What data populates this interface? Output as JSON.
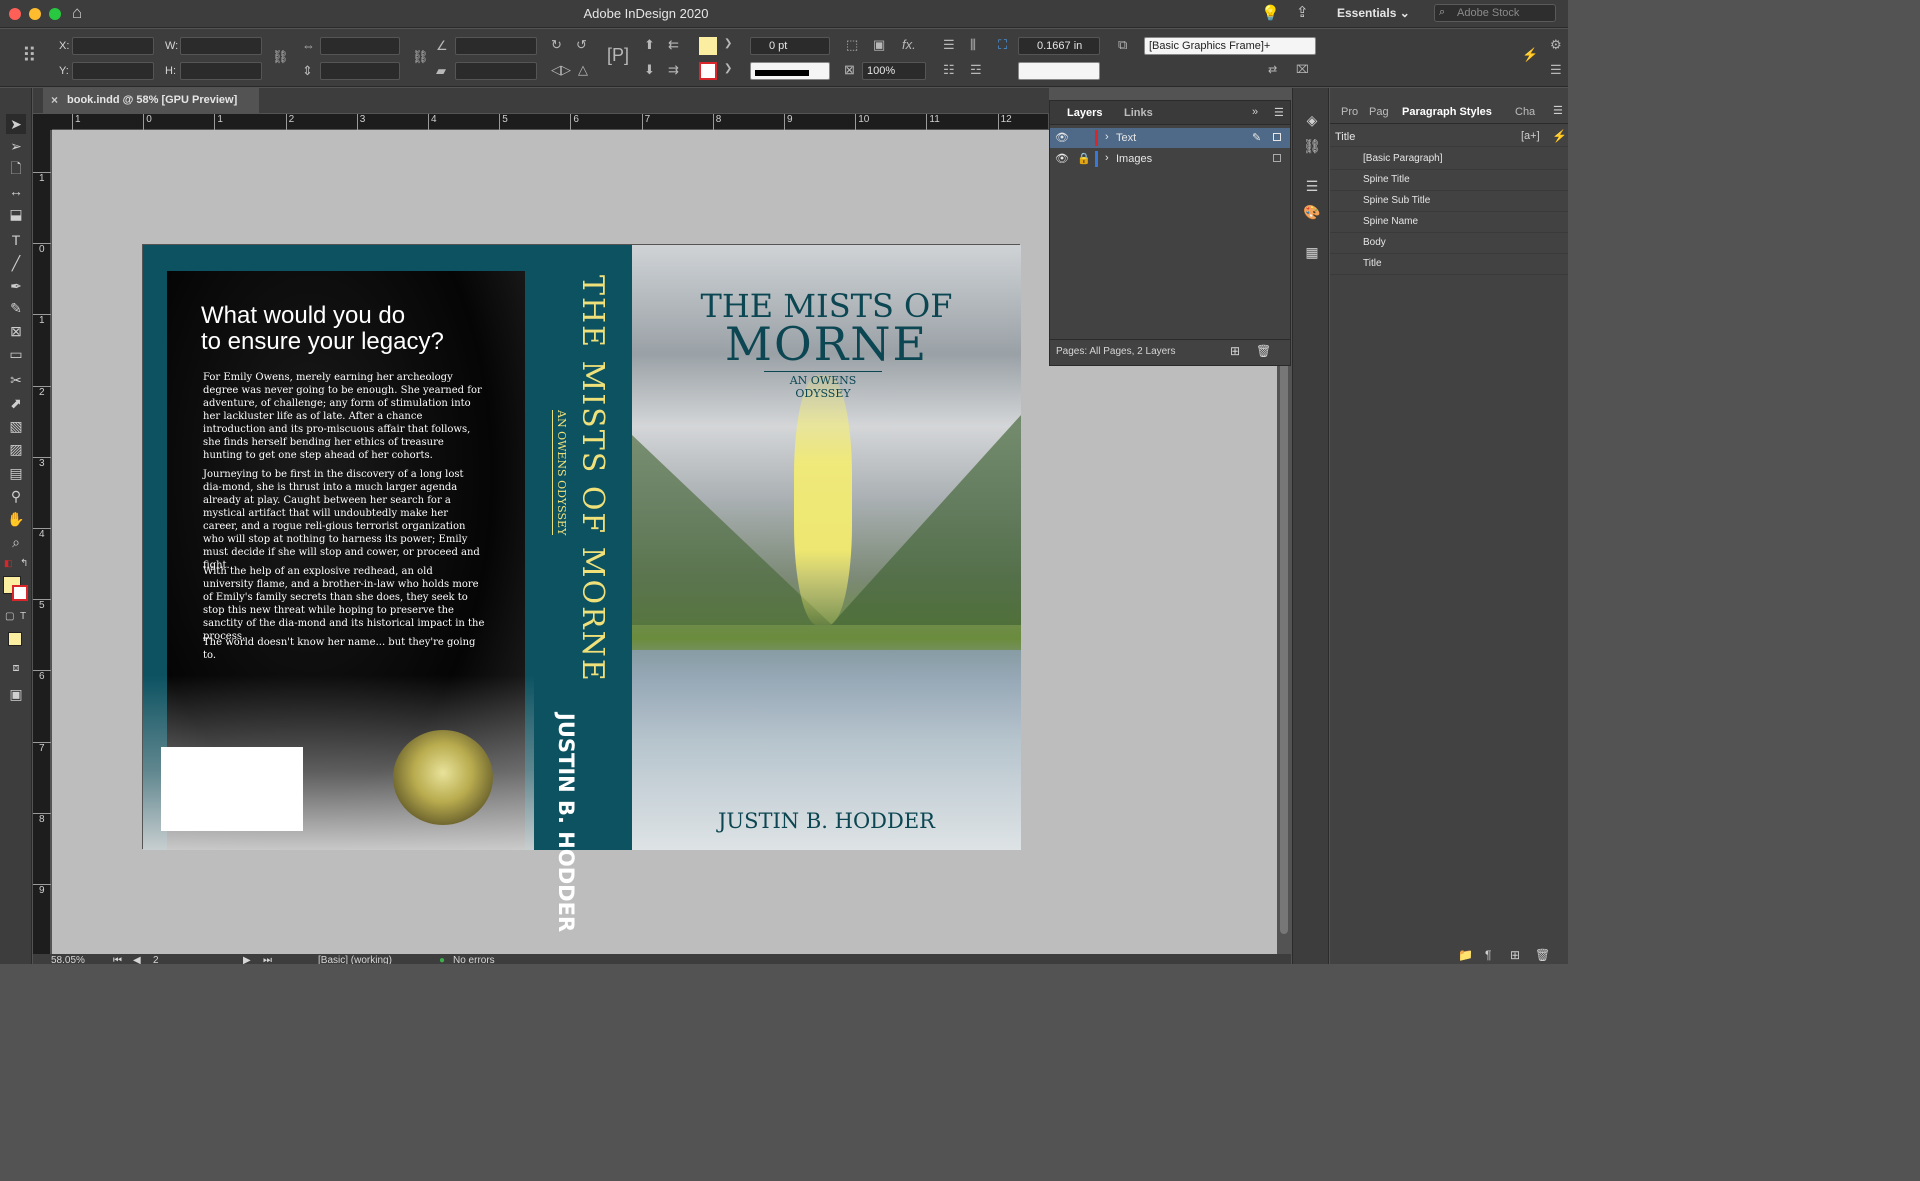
{
  "window": {
    "title": "Adobe InDesign 2020",
    "workspace": "Essentials",
    "search_placeholder": "Adobe Stock"
  },
  "controlbar": {
    "x_label": "X:",
    "y_label": "Y:",
    "w_label": "W:",
    "h_label": "H:",
    "stroke_weight": "0 pt",
    "opacity": "100%",
    "frame_inset": "0.1667 in",
    "object_style": "[Basic Graphics Frame]+",
    "fill_color": "#fbeea0"
  },
  "document": {
    "tab_label": "book.indd @ 58% [GPU Preview]"
  },
  "rulers": {
    "horizontal": [
      "1",
      "0",
      "1",
      "2",
      "3",
      "4",
      "5",
      "6",
      "7",
      "8",
      "9",
      "10",
      "11",
      "12"
    ],
    "vertical": [
      "1",
      "0",
      "1",
      "2",
      "3",
      "4",
      "5",
      "6",
      "7",
      "8",
      "9"
    ]
  },
  "cover": {
    "back_headline_1": "What would you do",
    "back_headline_2": "to ensure your legacy?",
    "blurb_1": "For Emily Owens, merely earning her archeology degree was never going to be enough. She yearned for adventure, of challenge; any form of stimulation into her lackluster life as of late. After a chance introduction and its pro-miscuous affair that follows, she finds herself bending her ethics of treasure hunting to get one step ahead of her cohorts.",
    "blurb_2": "Journeying to be first in the discovery of a long lost dia-mond, she is thrust into a much larger agenda already at play. Caught between her search for a mystical artifact that will undoubtedly make her career, and a rogue reli-gious terrorist organization who will stop at nothing to harness its power; Emily must decide if she will stop and cower, or proceed and fight.",
    "blurb_3": "With the help of an explosive redhead, an old university flame, and a brother-in-law who holds more of Emily's family secrets than she does, they seek to stop this new threat while hoping to preserve the sanctity of the dia-mond and its historical impact in the process.",
    "blurb_4": "The world doesn't know her name... but they're going to.",
    "spine_title": "THE MISTS OF MORNE",
    "spine_subtitle": "AN OWENS ODYSSEY",
    "spine_author": "JUSTIN B. HODDER",
    "front_title_line1": "THE MISTS OF",
    "front_title_line2": "MORNE",
    "front_subtitle": "AN OWENS ODYSSEY",
    "front_author": "JUSTIN B. HODDER"
  },
  "layers_panel": {
    "tab_layers": "Layers",
    "tab_links": "Links",
    "layers": [
      {
        "name": "Text",
        "color": "#d9262a"
      },
      {
        "name": "Images",
        "color": "#3a78d8"
      }
    ],
    "footer": "Pages: All Pages, 2 Layers"
  },
  "paragraph_panel": {
    "tab_1": "Pro",
    "tab_2": "Pag",
    "tab_active": "Paragraph Styles",
    "tab_4": "Cha",
    "current_style": "Title",
    "styles": [
      "[Basic Paragraph]",
      "Spine Title",
      "Spine Sub Title",
      "Spine Name",
      "Body",
      "Title"
    ]
  },
  "statusbar": {
    "zoom": "58.05%",
    "page": "2",
    "profile": "[Basic] (working)",
    "preflight": "No errors"
  }
}
